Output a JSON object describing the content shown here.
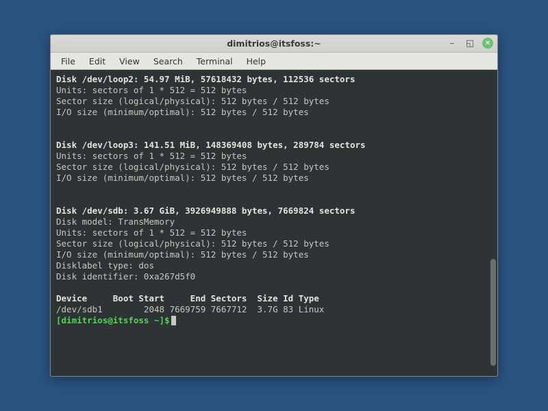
{
  "window": {
    "title": "dimitrios@itsfoss:~"
  },
  "menu": {
    "file": "File",
    "edit": "Edit",
    "view": "View",
    "search": "Search",
    "terminal": "Terminal",
    "help": "Help"
  },
  "term": {
    "loop2_header": "Disk /dev/loop2: 54.97 MiB, 57618432 bytes, 112536 sectors",
    "loop2_units": "Units: sectors of 1 * 512 = 512 bytes",
    "loop2_sector": "Sector size (logical/physical): 512 bytes / 512 bytes",
    "loop2_io": "I/O size (minimum/optimal): 512 bytes / 512 bytes",
    "loop3_header": "Disk /dev/loop3: 141.51 MiB, 148369408 bytes, 289784 sectors",
    "loop3_units": "Units: sectors of 1 * 512 = 512 bytes",
    "loop3_sector": "Sector size (logical/physical): 512 bytes / 512 bytes",
    "loop3_io": "I/O size (minimum/optimal): 512 bytes / 512 bytes",
    "sdb_header": "Disk /dev/sdb: 3.67 GiB, 3926949888 bytes, 7669824 sectors",
    "sdb_model": "Disk model: TransMemory",
    "sdb_units": "Units: sectors of 1 * 512 = 512 bytes",
    "sdb_sector": "Sector size (logical/physical): 512 bytes / 512 bytes",
    "sdb_io": "I/O size (minimum/optimal): 512 bytes / 512 bytes",
    "sdb_label": "Disklabel type: dos",
    "sdb_ident": "Disk identifier: 0xa267d5f0",
    "part_header": "Device     Boot Start     End Sectors  Size Id Type",
    "part_row": "/dev/sdb1        2048 7669759 7667712  3.7G 83 Linux",
    "prompt_user": "[dimitrios@itsfoss ~]",
    "prompt_sign": "$"
  }
}
